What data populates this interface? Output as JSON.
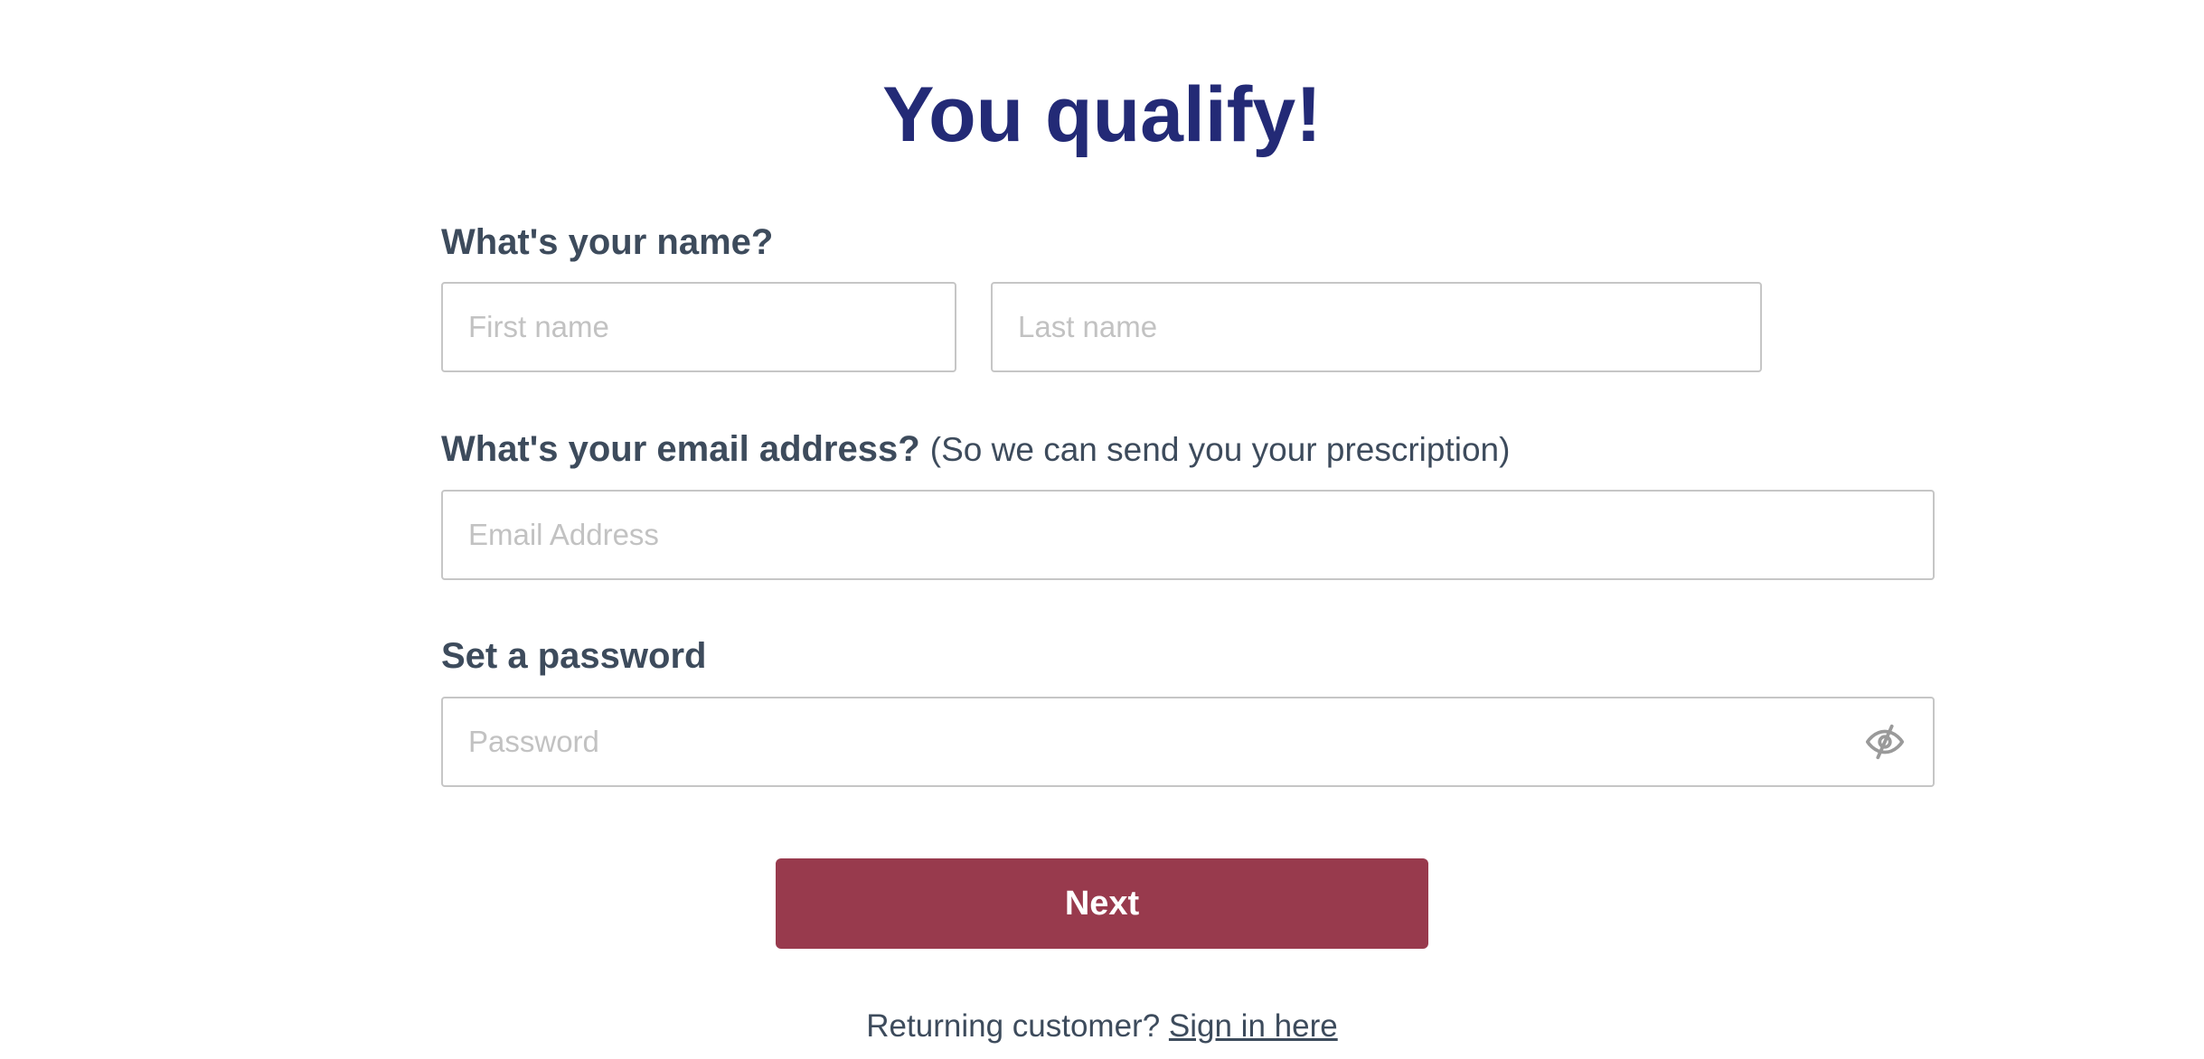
{
  "header": {
    "title": "You qualify!"
  },
  "name_section": {
    "label": "What's your name?",
    "first_name_placeholder": "First name",
    "last_name_placeholder": "Last name"
  },
  "email_section": {
    "label": "What's your email address?",
    "sublabel": "(So we can send you your prescription)",
    "placeholder": "Email Address"
  },
  "password_section": {
    "label": "Set a password",
    "placeholder": "Password",
    "toggle_icon": "eye-slash-icon"
  },
  "actions": {
    "next_label": "Next"
  },
  "footer": {
    "returning_text": "Returning customer?",
    "sign_in_link": "Sign in here"
  },
  "colors": {
    "title": "#232a76",
    "label": "#3d4b5c",
    "button": "#983a4d",
    "border": "#c6c6c6",
    "placeholder": "#c2c2c2"
  }
}
